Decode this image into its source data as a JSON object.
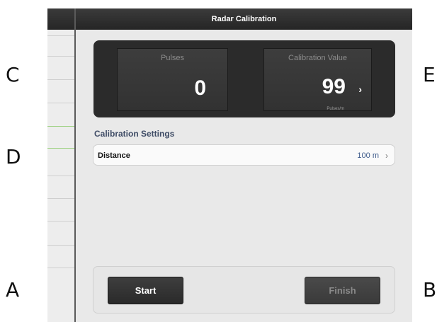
{
  "callouts": {
    "A": "A",
    "B": "B",
    "C": "C",
    "D": "D",
    "E": "E"
  },
  "navbar": {
    "title": "Radar Calibration"
  },
  "readout": {
    "pulses": {
      "label": "Pulses",
      "value": "0"
    },
    "calibration": {
      "label": "Calibration Value",
      "value": "99",
      "unit": "Pulses/m",
      "chevron": "›"
    }
  },
  "settings": {
    "title": "Calibration Settings",
    "distance": {
      "label": "Distance",
      "value": "100 m",
      "chevron": "›"
    }
  },
  "buttons": {
    "start": "Start",
    "finish": "Finish"
  },
  "colors": {
    "navbar": "#2e2e2e",
    "accent_text": "#3d5a8a",
    "selection_line": "#9bd07f"
  }
}
